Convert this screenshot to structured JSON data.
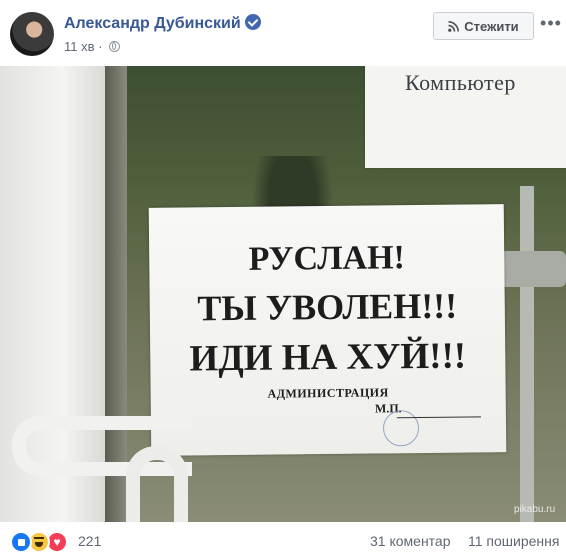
{
  "post": {
    "author": "Александр Дубинский",
    "time": "11 хв",
    "follow_label": "Стежити",
    "more_label": "•••"
  },
  "photo": {
    "top_sign_text": "Компьютер",
    "sign_lines": [
      "РУСЛАН!",
      "ТЫ УВОЛЕН!!!",
      "ИДИ НА ХУЙ!!!",
      "АДМИНИСТРАЦИЯ",
      "М.П."
    ],
    "watermark": "pikabu.ru"
  },
  "footer": {
    "reactions": [
      "like-icon",
      "haha-icon",
      "love-icon"
    ],
    "reaction_count": "221",
    "comments": "31 коментар",
    "shares": "11 поширення"
  },
  "colors": {
    "author_link": "#385898",
    "like": "#1877f2",
    "love": "#f33e58",
    "haha": "#f7c744"
  }
}
